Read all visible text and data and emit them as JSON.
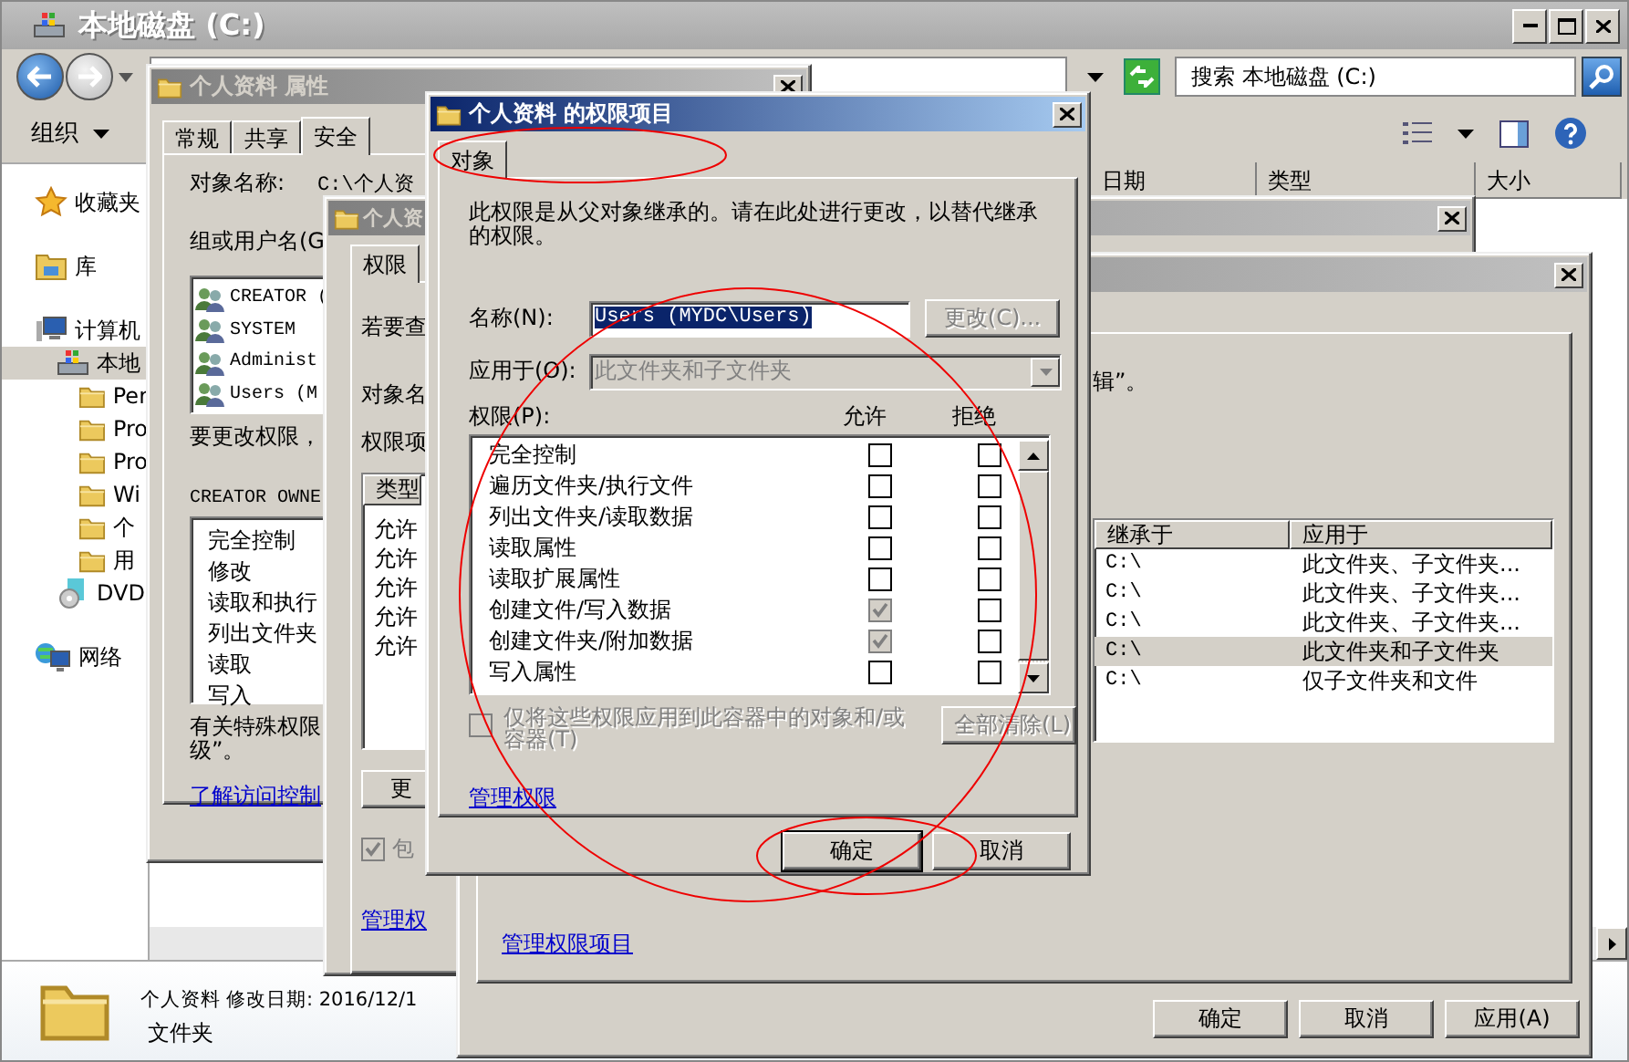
{
  "explorer": {
    "title": "本地磁盘 (C:)",
    "search": {
      "placeholder": "搜索 本地磁盘 (C:)"
    },
    "toolbar": {
      "organize": "组织"
    },
    "sidebar": [
      {
        "label": "收藏夹",
        "kind": "favorites",
        "selected": false
      },
      {
        "label": "库",
        "kind": "library",
        "selected": false
      },
      {
        "label": "计算机",
        "kind": "computer",
        "selected": false,
        "children": [
          {
            "label": "本地",
            "kind": "drive",
            "selected": true,
            "children": [
              {
                "label": "Per",
                "kind": "folder",
                "selected": false
              },
              {
                "label": "Pro",
                "kind": "folder",
                "selected": false
              },
              {
                "label": "Pro",
                "kind": "folder",
                "selected": false
              },
              {
                "label": "Wi",
                "kind": "folder",
                "selected": false
              },
              {
                "label": "个",
                "kind": "folder",
                "selected": false
              },
              {
                "label": "用",
                "kind": "folder",
                "selected": false
              }
            ]
          },
          {
            "label": "DVD",
            "kind": "dvd",
            "selected": false
          }
        ]
      },
      {
        "label": "网络",
        "kind": "network",
        "selected": false
      }
    ],
    "columns": [
      "日期",
      "类型",
      "大小"
    ],
    "details": {
      "name": "个人资料",
      "modified": "修改日期: 2016/12/1",
      "type": "文件夹"
    }
  },
  "properties_dialog": {
    "title": "个人资料 属性",
    "active": false,
    "tabs": [
      {
        "label": "常规",
        "selected": false
      },
      {
        "label": "共享",
        "selected": false
      },
      {
        "label": "安全",
        "selected": true
      }
    ],
    "object_label": "对象名称:",
    "object_value": "C:\\个人资",
    "group_label": "组或用户名(G",
    "users": [
      "CREATOR (",
      "SYSTEM",
      "Administ",
      "Users (M"
    ],
    "change_hint": "要更改权限，",
    "permissions_header": "CREATOR OWNE",
    "permissions": [
      "完全控制",
      "修改",
      "读取和执行",
      "列出文件夹",
      "读取",
      "写入"
    ],
    "special_note": [
      "有关特殊权限",
      "级”。"
    ],
    "link": "了解访问控制"
  },
  "advanced_dialog": {
    "title": "个人资",
    "active": false,
    "tab": "权限",
    "hint": "若要查",
    "object_label": "对象名",
    "entries_label": "权限项",
    "column": "类型",
    "rows": [
      "允许",
      "允许",
      "允许",
      "允许",
      "允许"
    ],
    "button": "更",
    "inherit_checkbox": {
      "label": "包",
      "checked": true,
      "disabled": true
    },
    "link": "管理权"
  },
  "edit_dialog": {
    "active": false,
    "hint_tail": "辑”。",
    "columns": [
      "继承于",
      "应用于"
    ],
    "rows": [
      {
        "inherited_from": "C:\\",
        "applies_to": "此文件夹、子文件夹...",
        "selected": false
      },
      {
        "inherited_from": "C:\\",
        "applies_to": "此文件夹、子文件夹...",
        "selected": false
      },
      {
        "inherited_from": "C:\\",
        "applies_to": "此文件夹、子文件夹...",
        "selected": false
      },
      {
        "inherited_from": "C:\\",
        "applies_to": "此文件夹和子文件夹",
        "selected": true
      },
      {
        "inherited_from": "C:\\",
        "applies_to": "仅子文件夹和文件",
        "selected": false
      }
    ],
    "link": "管理权限项目",
    "buttons": [
      "确定",
      "取消",
      "应用(A)"
    ]
  },
  "entry_dialog": {
    "title": "个人资料 的权限项目",
    "active": true,
    "tab": {
      "label": "对象",
      "selected": true
    },
    "info": "此权限是从父对象继承的。请在此处进行更改，以替代继承的权限。",
    "name_label": "名称(N):",
    "name_value": "Users (MYDC\\Users)",
    "name_text_selected": true,
    "change_button": {
      "label": "更改(C)...",
      "disabled": true
    },
    "apply_label": "应用于(O):",
    "apply_value": "此文件夹和子文件夹",
    "apply_disabled": true,
    "permissions_label": "权限(P):",
    "allow_header": "允许",
    "deny_header": "拒绝",
    "permissions": [
      {
        "label": "完全控制",
        "allow": {
          "checked": false,
          "disabled": false
        },
        "deny": {
          "checked": false,
          "disabled": false
        }
      },
      {
        "label": "遍历文件夹/执行文件",
        "allow": {
          "checked": false,
          "disabled": false
        },
        "deny": {
          "checked": false,
          "disabled": false
        }
      },
      {
        "label": "列出文件夹/读取数据",
        "allow": {
          "checked": false,
          "disabled": false
        },
        "deny": {
          "checked": false,
          "disabled": false
        }
      },
      {
        "label": "读取属性",
        "allow": {
          "checked": false,
          "disabled": false
        },
        "deny": {
          "checked": false,
          "disabled": false
        }
      },
      {
        "label": "读取扩展属性",
        "allow": {
          "checked": false,
          "disabled": false
        },
        "deny": {
          "checked": false,
          "disabled": false
        }
      },
      {
        "label": "创建文件/写入数据",
        "allow": {
          "checked": true,
          "disabled": true
        },
        "deny": {
          "checked": false,
          "disabled": false
        }
      },
      {
        "label": "创建文件夹/附加数据",
        "allow": {
          "checked": true,
          "disabled": true
        },
        "deny": {
          "checked": false,
          "disabled": false
        }
      },
      {
        "label": "写入属性",
        "allow": {
          "checked": false,
          "disabled": false
        },
        "deny": {
          "checked": false,
          "disabled": false
        }
      }
    ],
    "container_checkbox": {
      "label": "仅将这些权限应用到此容器中的对象和/或容器(T)",
      "checked": false,
      "disabled": true
    },
    "clear_button": {
      "label": "全部清除(L)",
      "disabled": true
    },
    "link": "管理权限",
    "buttons": [
      {
        "label": "确定",
        "kind": "default"
      },
      {
        "label": "取消",
        "kind": "normal"
      }
    ]
  },
  "annotations": [
    {
      "kind": "ellipse"
    },
    {
      "kind": "ellipse"
    },
    {
      "kind": "ellipse"
    }
  ]
}
